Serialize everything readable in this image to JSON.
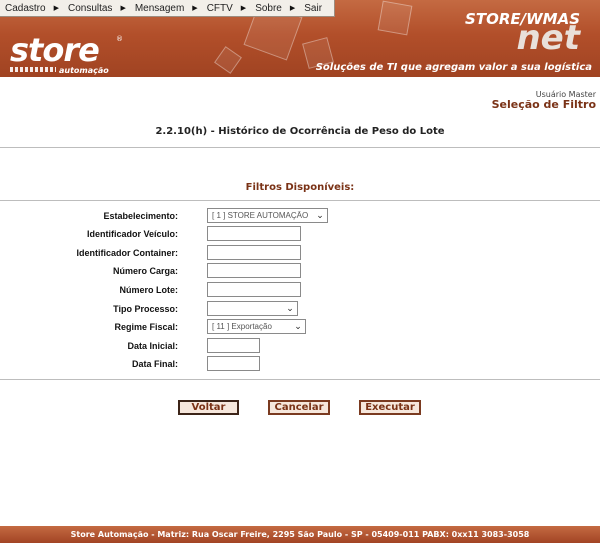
{
  "menu": {
    "items": [
      "Cadastro",
      "Consultas",
      "Mensagem",
      "CFTV",
      "Sobre",
      "Sair"
    ]
  },
  "header": {
    "logo": "store",
    "logo_registered": "®",
    "logo_subtitle": "automação",
    "brand_top": "STORE/WMAS",
    "brand_net": "net",
    "tagline": "Soluções de TI que agregam valor a sua logística"
  },
  "user": {
    "name": "Usuário Master",
    "mode": "Seleção de Filtro"
  },
  "page": {
    "title": "2.2.10(h) - Histórico de Ocorrência de Peso do Lote",
    "filters_title": "Filtros Disponíveis:"
  },
  "form": {
    "estabelecimento": {
      "label": "Estabelecimento:",
      "value": "[ 1 ] STORE AUTOMAÇÃO"
    },
    "identificador_veiculo": {
      "label": "Identificador Veículo:",
      "value": ""
    },
    "identificador_container": {
      "label": "Identificador Container:",
      "value": ""
    },
    "numero_carga": {
      "label": "Número Carga:",
      "value": ""
    },
    "numero_lote": {
      "label": "Número Lote:",
      "value": ""
    },
    "tipo_processo": {
      "label": "Tipo Processo:",
      "value": ""
    },
    "regime_fiscal": {
      "label": "Regime Fiscal:",
      "value": "[ 11 ] Exportação"
    },
    "data_inicial": {
      "label": "Data Inicial:",
      "value": ""
    },
    "data_final": {
      "label": "Data Final:",
      "value": ""
    }
  },
  "buttons": {
    "voltar": "Voltar",
    "cancelar": "Cancelar",
    "executar": "Executar"
  },
  "footer": {
    "text": "Store Automação - Matriz: Rua Oscar Freire, 2295 São Paulo - SP - 05409-011 PABX: 0xx11 3083-3058"
  },
  "colors": {
    "header_brown": "#b24f2a",
    "accent_text": "#7a3216",
    "button_bg": "#f6e7dc"
  }
}
